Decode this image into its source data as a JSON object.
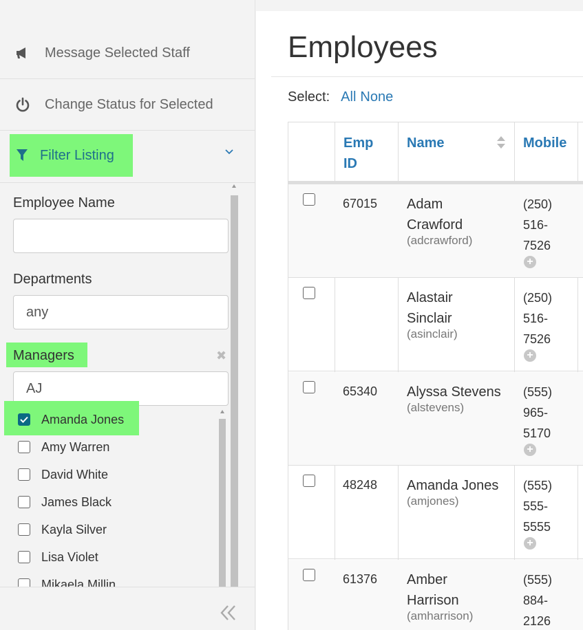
{
  "sidebar": {
    "actions": [
      {
        "label": "Message Selected Staff",
        "icon": "megaphone-icon"
      },
      {
        "label": "Change Status for Selected",
        "icon": "power-icon"
      }
    ],
    "filter": {
      "label": "Filter Listing",
      "icon": "filter-icon",
      "toggle_icon": "chevron-down-icon",
      "employee_name": {
        "label": "Employee Name",
        "value": ""
      },
      "departments": {
        "label": "Departments",
        "value": "any"
      },
      "managers": {
        "label": "Managers",
        "clear_icon": "close-icon",
        "search_value": "AJ",
        "options": [
          {
            "label": "Amanda Jones",
            "checked": true
          },
          {
            "label": "Amy Warren",
            "checked": false
          },
          {
            "label": "David White",
            "checked": false
          },
          {
            "label": "James Black",
            "checked": false
          },
          {
            "label": "Kayla Silver",
            "checked": false
          },
          {
            "label": "Lisa Violet",
            "checked": false
          },
          {
            "label": "Mikaela Millin",
            "checked": false
          }
        ]
      }
    },
    "collapse_icon": "double-chevron-left-icon"
  },
  "main": {
    "title": "Employees",
    "select_label": "Select:",
    "select_all": "All",
    "select_none": "None",
    "columns": {
      "emp_id_line1": "Emp",
      "emp_id_line2": "ID",
      "name": "Name",
      "mobile": "Mobile"
    },
    "rows": [
      {
        "emp_id": "67015",
        "name_line1": "Adam",
        "name_line2": "Crawford",
        "username": "(adcrawford)",
        "mobile": [
          "(250)",
          "516-",
          "7526"
        ]
      },
      {
        "emp_id": "",
        "name_line1": "Alastair",
        "name_line2": "Sinclair",
        "username": "(asinclair)",
        "mobile": [
          "(250)",
          "516-",
          "7526"
        ]
      },
      {
        "emp_id": "65340",
        "name_line1": "Alyssa Stevens",
        "name_line2": "",
        "username": "(alstevens)",
        "mobile": [
          "(555)",
          "965-",
          "5170"
        ]
      },
      {
        "emp_id": "48248",
        "name_line1": "Amanda Jones",
        "name_line2": "",
        "username": "(amjones)",
        "mobile": [
          "(555)",
          "555-",
          "5555"
        ]
      },
      {
        "emp_id": "61376",
        "name_line1": "Amber",
        "name_line2": "Harrison",
        "username": "(amharrison)",
        "mobile": [
          "(555)",
          "884-",
          "2126"
        ]
      }
    ]
  },
  "colors": {
    "highlight": "#7ef77a",
    "link": "#2a79b4",
    "checked": "#0b6a84"
  }
}
